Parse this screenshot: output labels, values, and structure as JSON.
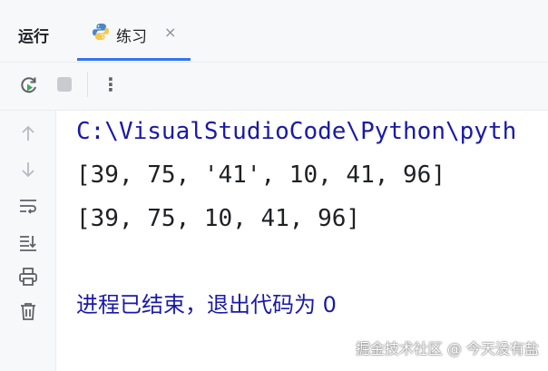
{
  "header": {
    "run_label": "运行",
    "tab": {
      "label": "练习",
      "close": "×",
      "icon": "python-icon"
    }
  },
  "toolbar": {
    "icons": [
      "rerun-icon",
      "stop-icon",
      "more-vertical-icon"
    ],
    "more": "⋮"
  },
  "sidebar": {
    "icons": [
      "arrow-up-icon",
      "arrow-down-icon",
      "soft-wrap-icon",
      "scroll-to-end-icon",
      "print-icon",
      "trash-icon"
    ]
  },
  "console": {
    "command": "C:\\VisualStudioCode\\Python\\pyth",
    "output_1": "[39, 75, '41', 10, 41, 96]",
    "output_2": "[39, 75, 10, 41, 96]",
    "exit_message": "进程已结束，退出代码为 0"
  },
  "watermark": "掘金技术社区 @ 今天没有盐",
  "colors": {
    "accent": "#3574f0",
    "console_blue": "#1a1aa6",
    "panel_bg": "#f7f8fa"
  }
}
